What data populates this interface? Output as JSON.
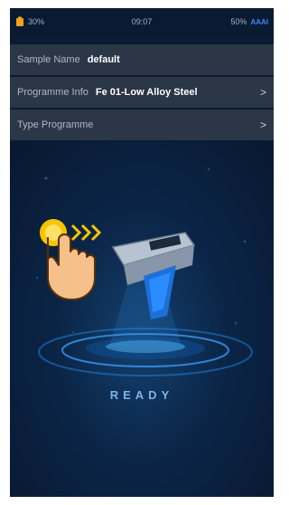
{
  "status_bar": {
    "battery_left": "30%",
    "time": "09:07",
    "battery_right": "50%",
    "network": "AAAI"
  },
  "rows": {
    "sample_name": {
      "label": "Sample Name",
      "value": "default"
    },
    "programme_info": {
      "label": "Programme Info",
      "value": "Fe 01-Low Alloy Steel"
    },
    "type_programme": {
      "label": "Type Programme"
    }
  },
  "main": {
    "status": "READY"
  },
  "icons": {
    "chevron": "chevron-right-icon",
    "battery": "battery-icon",
    "hand": "tap-hand-icon",
    "device": "handheld-analyzer-icon"
  },
  "colors": {
    "accent": "#3c88ff",
    "ready": "#7fb3e8",
    "background": "#0a1b33",
    "row": "#2b3646"
  }
}
